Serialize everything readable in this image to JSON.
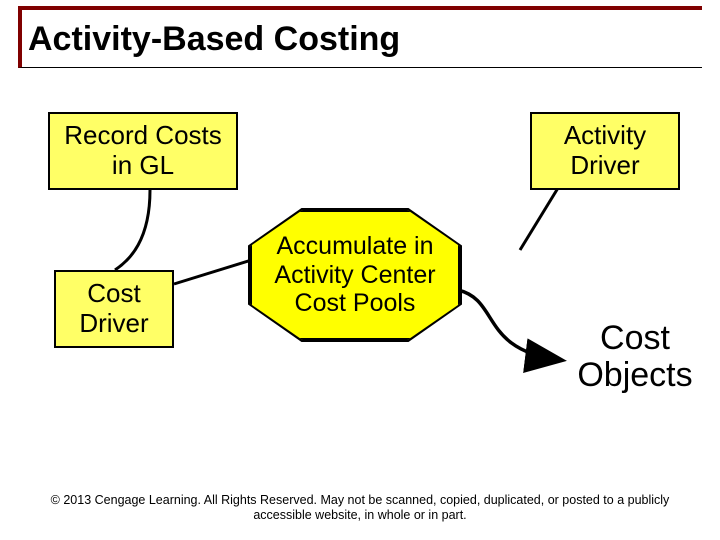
{
  "title": "Activity-Based Costing",
  "boxes": {
    "record": "Record Costs in GL",
    "activityDriver": "Activity Driver",
    "costDriver": "Cost Driver",
    "accumulate": "Accumulate in Activity Center Cost Pools",
    "costObjects": "Cost Objects"
  },
  "footer": "© 2013 Cengage Learning.  All Rights Reserved.  May not be scanned, copied, duplicated, or posted to a publicly accessible website, in whole or in part."
}
